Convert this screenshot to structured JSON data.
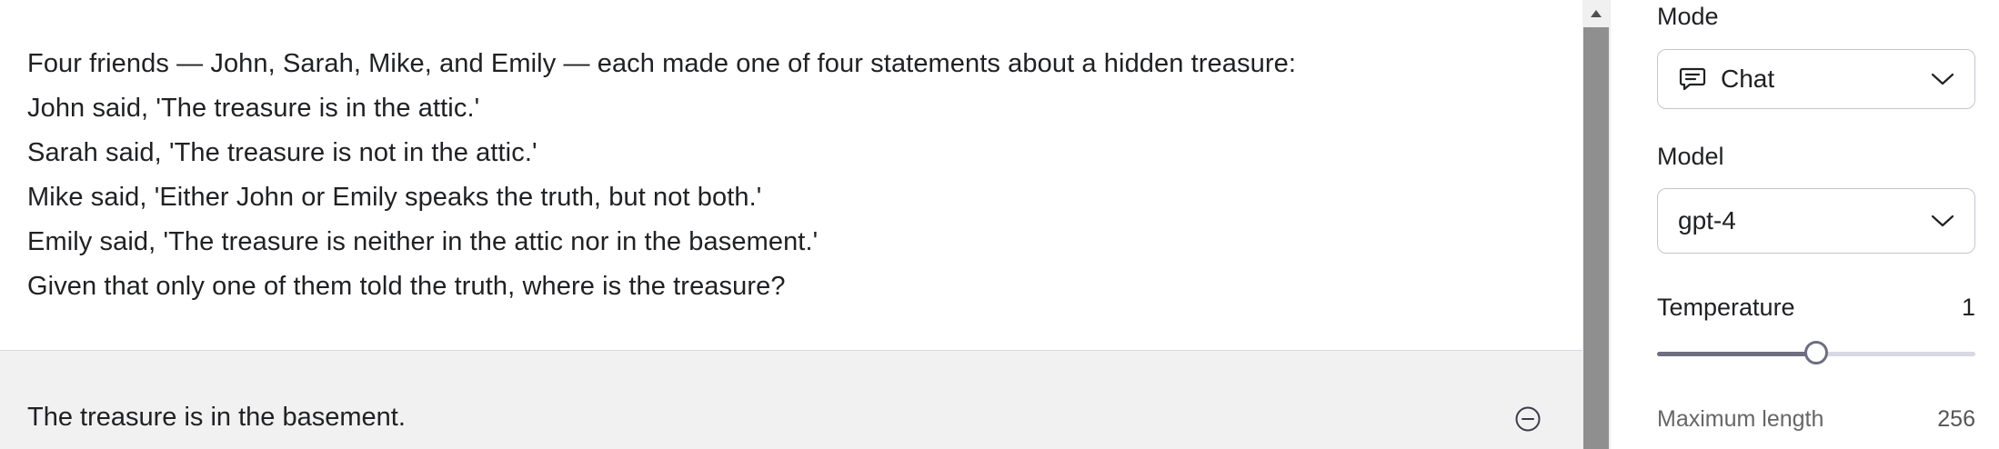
{
  "conversation": {
    "user_lines": [
      "Four friends — John, Sarah, Mike, and Emily — each made one of four statements about a hidden treasure:",
      "John said, 'The treasure is in the attic.'",
      "Sarah said, 'The treasure is not in the attic.'",
      "Mike said, 'Either John or Emily speaks the truth, but not both.'",
      "Emily said, 'The treasure is neither in the attic nor in the basement.'",
      "Given that only one of them told the truth, where is the treasure?"
    ],
    "assistant_text": "The treasure is in the basement."
  },
  "settings": {
    "mode_label": "Mode",
    "mode_value": "Chat",
    "model_label": "Model",
    "model_value": "gpt-4",
    "temperature_label": "Temperature",
    "temperature_value": "1",
    "temperature_fraction": 0.5,
    "next_setting_partial": "Maximum length",
    "next_setting_value_partial": "256"
  },
  "icons": {
    "mode_icon": "chat-bubble-icon",
    "dropdown_icon": "chevron-down-icon",
    "remove_icon": "minus-circle-icon",
    "scroll_up_icon": "arrow-up-icon"
  }
}
